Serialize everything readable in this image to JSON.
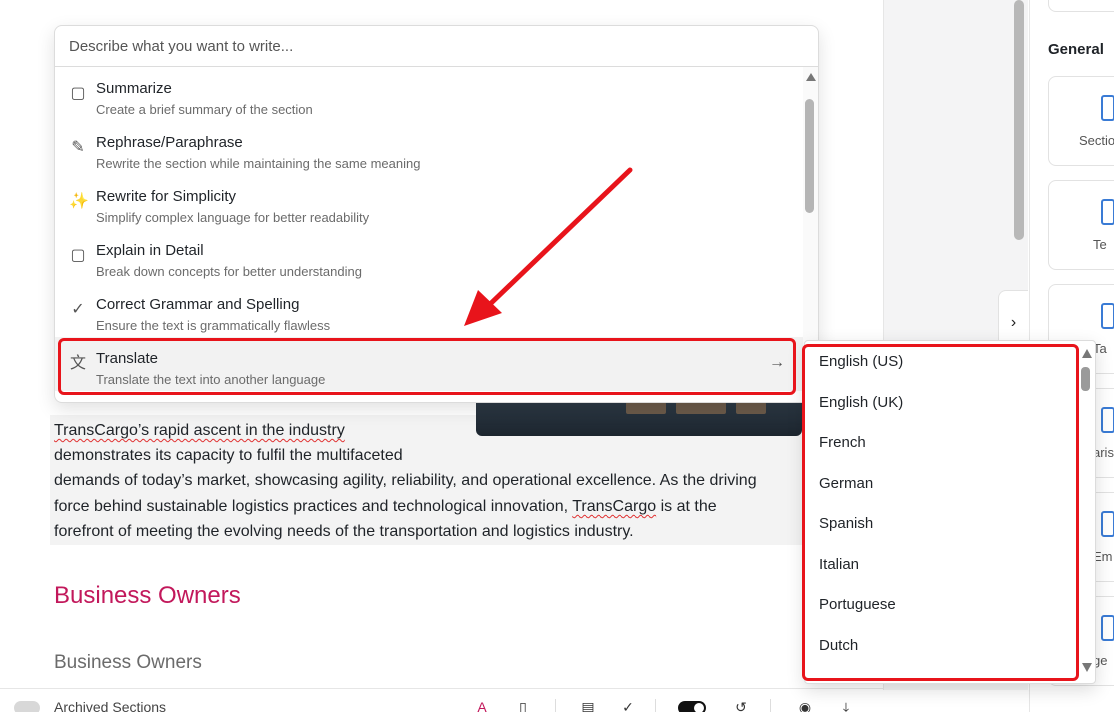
{
  "ai_popup": {
    "input_placeholder": "Describe what you want to write...",
    "items": [
      {
        "title": "Summarize",
        "subtitle": "Create a brief summary of the section",
        "icon": "comment-icon"
      },
      {
        "title": "Rephrase/Paraphrase",
        "subtitle": "Rewrite the section while maintaining the same meaning",
        "icon": "edit-icon"
      },
      {
        "title": "Rewrite for Simplicity",
        "subtitle": "Simplify complex language for better readability",
        "icon": "magic-wand-icon"
      },
      {
        "title": "Explain in Detail",
        "subtitle": "Break down concepts for better understanding",
        "icon": "comment-icon"
      },
      {
        "title": "Correct Grammar and Spelling",
        "subtitle": "Ensure the text is grammatically flawless",
        "icon": "check-circle-icon"
      },
      {
        "title": "Translate",
        "subtitle": "Translate the text into another language",
        "icon": "translate-icon"
      }
    ]
  },
  "languages": [
    "English (US)",
    "English (UK)",
    "French",
    "German",
    "Spanish",
    "Italian",
    "Portuguese",
    "Dutch"
  ],
  "document": {
    "line1": "TransCargo’s rapid ascent in the industry",
    "line2": "demonstrates its capacity to fulfil the multifaceted",
    "line3": "demands of today’s market, showcasing agility, reliability, and operational excellence. As the driving",
    "line4_pre": "force behind sustainable logistics practices and technological innovation, ",
    "line4_brand": "TransCargo",
    "line4_post": " is at the",
    "line5": "forefront of meeting the evolving needs of the transportation and logistics industry.",
    "heading": "Business Owners",
    "subheading": "Business Owners"
  },
  "bottom_bar": {
    "archived_label": "Archived Sections"
  },
  "right_panel": {
    "title": "General",
    "tiles": [
      "Sectio",
      "Te",
      "Ta",
      "aris",
      "Em",
      "ge"
    ]
  },
  "colors": {
    "annotation": "#e8141b",
    "heading": "#c2185b"
  }
}
